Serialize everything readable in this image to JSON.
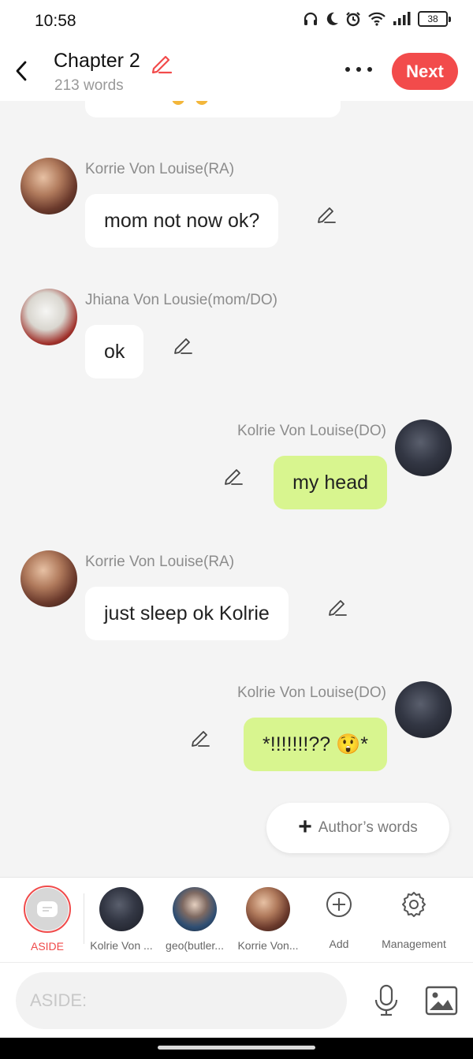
{
  "status_bar": {
    "time": "10:58",
    "battery": "38",
    "icons": [
      "headphones-icon",
      "moon-icon",
      "alarm-icon",
      "wifi-icon",
      "signal-icon",
      "battery-icon"
    ]
  },
  "header": {
    "title": "Chapter 2",
    "word_count": "213 words",
    "next_label": "Next",
    "accent_color": "#f24b4b"
  },
  "messages": [
    {
      "speaker": "Korrie Von Louise(RA)",
      "text": "mom not now ok?",
      "side": "left",
      "avatar": "warm"
    },
    {
      "speaker": "Jhiana Von Lousie(mom/DO)",
      "text": "ok",
      "side": "left",
      "avatar": "white"
    },
    {
      "speaker": "Kolrie Von Louise(DO)",
      "text": "my head",
      "side": "right",
      "avatar": "dark"
    },
    {
      "speaker": "Korrie Von Louise(RA)",
      "text": "just sleep ok Kolrie",
      "side": "left",
      "avatar": "warm"
    },
    {
      "speaker": "Kolrie Von Louise(DO)",
      "text": "*!!!!!!!?? 😲*",
      "side": "right",
      "avatar": "dark"
    }
  ],
  "authors_words_label": "Author’s words",
  "character_bar": {
    "aside_label": "ASIDE",
    "characters": [
      {
        "label": "Kolrie Von ...",
        "avatar": "dark"
      },
      {
        "label": "geo(butler...",
        "avatar": "blue"
      },
      {
        "label": "Korrie Von...",
        "avatar": "warm"
      }
    ],
    "add_label": "Add",
    "management_label": "Management"
  },
  "input": {
    "placeholder": "ASIDE:",
    "value": ""
  },
  "colors": {
    "right_bubble": "#d8f58f",
    "left_bubble": "#ffffff",
    "background": "#f4f4f4"
  }
}
